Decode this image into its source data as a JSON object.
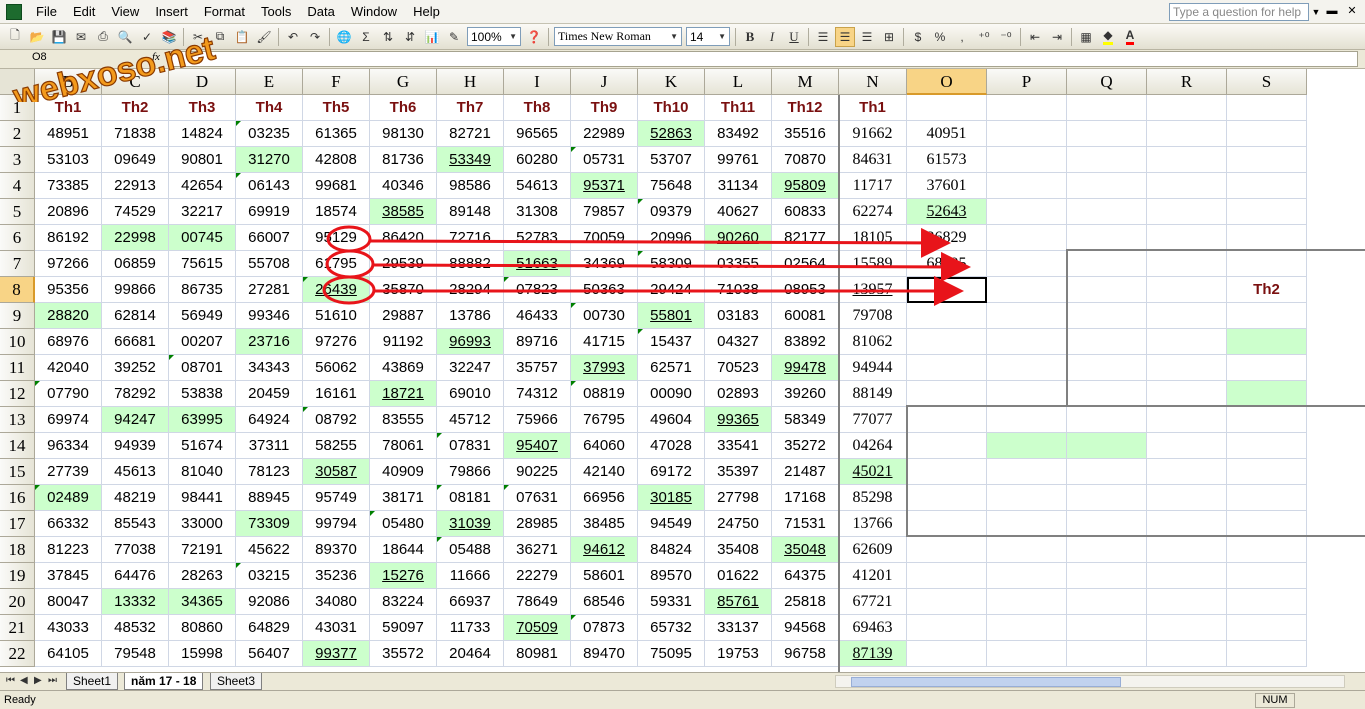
{
  "menu": [
    "File",
    "Edit",
    "View",
    "Insert",
    "Format",
    "Tools",
    "Data",
    "Window",
    "Help"
  ],
  "help_placeholder": "Type a question for help",
  "toolbar": {
    "zoom": "100%",
    "font": "Times New Roman",
    "size": "14",
    "sigma": "Σ",
    "bold": "B",
    "italic": "I",
    "underline": "U",
    "currency": "$",
    "percent": "%",
    "fill_color": "#ffff00",
    "font_color": "#ff0000"
  },
  "formula_bar": {
    "name_box": "O8",
    "fx": "fx"
  },
  "logo_text": "webxoso.net",
  "columns": [
    "B",
    "C",
    "D",
    "E",
    "F",
    "G",
    "H",
    "I",
    "J",
    "K",
    "L",
    "M",
    "N",
    "O",
    "P",
    "Q",
    "R",
    "S"
  ],
  "active_column": "O",
  "active_row": 8,
  "header_row": [
    "Th1",
    "Th2",
    "Th3",
    "Th4",
    "Th5",
    "Th6",
    "Th7",
    "Th8",
    "Th9",
    "Th10",
    "Th11",
    "Th12",
    "Th1"
  ],
  "rows": [
    {
      "n": 2,
      "v": [
        "48951",
        "71838",
        "14824",
        "03235",
        "61365",
        "98130",
        "82721",
        "96565",
        "22989",
        "52863",
        "83492",
        "35516",
        "91662"
      ]
    },
    {
      "n": 3,
      "v": [
        "53103",
        "09649",
        "90801",
        "31270",
        "42808",
        "81736",
        "53349",
        "60280",
        "05731",
        "53707",
        "99761",
        "70870",
        "84631"
      ]
    },
    {
      "n": 4,
      "v": [
        "73385",
        "22913",
        "42654",
        "06143",
        "99681",
        "40346",
        "98586",
        "54613",
        "95371",
        "75648",
        "31134",
        "95809",
        "11717"
      ]
    },
    {
      "n": 5,
      "v": [
        "20896",
        "74529",
        "32217",
        "69919",
        "18574",
        "38585",
        "89148",
        "31308",
        "79857",
        "09379",
        "40627",
        "60833",
        "62274"
      ]
    },
    {
      "n": 6,
      "v": [
        "86192",
        "22998",
        "00745",
        "66007",
        "95129",
        "86420",
        "72716",
        "52783",
        "70059",
        "20996",
        "90260",
        "82177",
        "18105"
      ]
    },
    {
      "n": 7,
      "v": [
        "97266",
        "06859",
        "75615",
        "55708",
        "61795",
        "29539",
        "88882",
        "51663",
        "34369",
        "58309",
        "03355",
        "02564",
        "15589"
      ]
    },
    {
      "n": 8,
      "v": [
        "95356",
        "99866",
        "86735",
        "27281",
        "26439",
        "35870",
        "28294",
        "07823",
        "50363",
        "29424",
        "71038",
        "08953",
        "13957"
      ]
    },
    {
      "n": 9,
      "v": [
        "28820",
        "62814",
        "56949",
        "99346",
        "51610",
        "29887",
        "13786",
        "46433",
        "00730",
        "55801",
        "03183",
        "60081",
        "79708"
      ]
    },
    {
      "n": 10,
      "v": [
        "68976",
        "66681",
        "00207",
        "23716",
        "97276",
        "91192",
        "96993",
        "89716",
        "41715",
        "15437",
        "04327",
        "83892",
        "81062"
      ]
    },
    {
      "n": 11,
      "v": [
        "42040",
        "39252",
        "08701",
        "34343",
        "56062",
        "43869",
        "32247",
        "35757",
        "37993",
        "62571",
        "70523",
        "99478",
        "94944"
      ]
    },
    {
      "n": 12,
      "v": [
        "07790",
        "78292",
        "53838",
        "20459",
        "16161",
        "18721",
        "69010",
        "74312",
        "08819",
        "00090",
        "02893",
        "39260",
        "88149"
      ]
    },
    {
      "n": 13,
      "v": [
        "69974",
        "94247",
        "63995",
        "64924",
        "08792",
        "83555",
        "45712",
        "75966",
        "76795",
        "49604",
        "99365",
        "58349",
        "77077"
      ]
    },
    {
      "n": 14,
      "v": [
        "96334",
        "94939",
        "51674",
        "37311",
        "58255",
        "78061",
        "07831",
        "95407",
        "64060",
        "47028",
        "33541",
        "35272",
        "04264"
      ]
    },
    {
      "n": 15,
      "v": [
        "27739",
        "45613",
        "81040",
        "78123",
        "30587",
        "40909",
        "79866",
        "90225",
        "42140",
        "69172",
        "35397",
        "21487",
        "45021"
      ]
    },
    {
      "n": 16,
      "v": [
        "02489",
        "48219",
        "98441",
        "88945",
        "95749",
        "38171",
        "08181",
        "07631",
        "66956",
        "30185",
        "27798",
        "17168",
        "85298"
      ]
    },
    {
      "n": 17,
      "v": [
        "66332",
        "85543",
        "33000",
        "73309",
        "99794",
        "05480",
        "31039",
        "28985",
        "38485",
        "94549",
        "24750",
        "71531",
        "13766"
      ]
    },
    {
      "n": 18,
      "v": [
        "81223",
        "77038",
        "72191",
        "45622",
        "89370",
        "18644",
        "05488",
        "36271",
        "94612",
        "84824",
        "35408",
        "35048",
        "62609"
      ]
    },
    {
      "n": 19,
      "v": [
        "37845",
        "64476",
        "28263",
        "03215",
        "35236",
        "15276",
        "11666",
        "22279",
        "58601",
        "89570",
        "01622",
        "64375",
        "41201"
      ]
    },
    {
      "n": 20,
      "v": [
        "80047",
        "13332",
        "34365",
        "92086",
        "34080",
        "83224",
        "66937",
        "78649",
        "68546",
        "59331",
        "85761",
        "25818",
        "67721"
      ]
    },
    {
      "n": 21,
      "v": [
        "43033",
        "48532",
        "80860",
        "64829",
        "43031",
        "59097",
        "11733",
        "70509",
        "07873",
        "65732",
        "33137",
        "94568",
        "69463"
      ]
    },
    {
      "n": 22,
      "v": [
        "64105",
        "79548",
        "15998",
        "56407",
        "99377",
        "35572",
        "20464",
        "80981",
        "89470",
        "75095",
        "19753",
        "96758",
        "87139"
      ]
    }
  ],
  "col_o_values": [
    "40951",
    "61573",
    "37601",
    "52643",
    "36829",
    "68495"
  ],
  "right_headers": [
    "Th2",
    "Th"
  ],
  "sheet_tabs": [
    "Sheet1",
    "năm 17 - 18",
    "Sheet3"
  ],
  "active_tab": "năm 17 - 18",
  "status": {
    "left": "Ready",
    "num": "NUM"
  },
  "annotation_color": "#e8141a"
}
